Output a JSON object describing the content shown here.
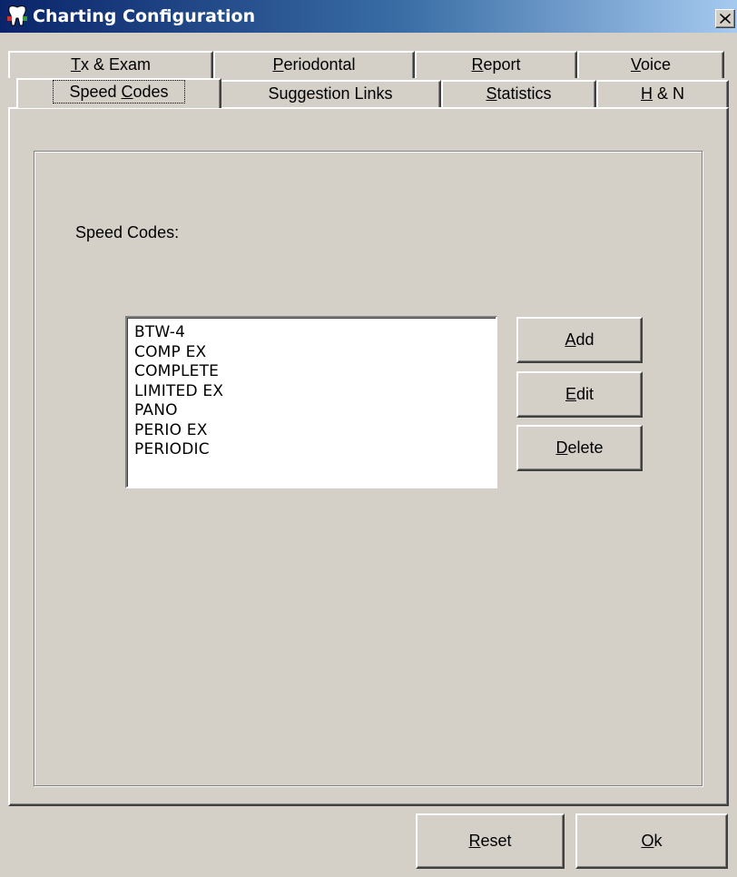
{
  "window": {
    "title": "Charting Configuration",
    "icon": "tooth-icon",
    "close_glyph": "✕"
  },
  "tabs": {
    "row_back": [
      {
        "pre": "",
        "accel": "T",
        "post": "x & Exam"
      },
      {
        "pre": "",
        "accel": "P",
        "post": "eriodontal"
      },
      {
        "pre": "",
        "accel": "R",
        "post": "eport"
      },
      {
        "pre": "",
        "accel": "V",
        "post": "oice"
      }
    ],
    "row_front": [
      {
        "pre": "Speed ",
        "accel": "C",
        "post": "odes",
        "active": true
      },
      {
        "pre": "Suggestion Links",
        "accel": "",
        "post": ""
      },
      {
        "pre": "",
        "accel": "S",
        "post": "tatistics"
      },
      {
        "pre": "",
        "accel": "H",
        "post": " & N"
      }
    ]
  },
  "panel": {
    "speed_codes_label": "Speed Codes:",
    "speed_codes": [
      "BTW-4",
      "COMP EX",
      "COMPLETE",
      "LIMITED EX",
      "PANO",
      "PERIO EX",
      "PERIODIC"
    ],
    "buttons": {
      "add": {
        "pre": "",
        "accel": "A",
        "post": "dd"
      },
      "edit": {
        "pre": "",
        "accel": "E",
        "post": "dit"
      },
      "delete": {
        "pre": "",
        "accel": "D",
        "post": "elete"
      }
    }
  },
  "footer": {
    "reset": {
      "pre": "",
      "accel": "R",
      "post": "eset"
    },
    "ok": {
      "pre": "",
      "accel": "O",
      "post": "k"
    }
  },
  "colors": {
    "titlebar_start": "#0a246a",
    "titlebar_end": "#a6caf0",
    "face": "#d4d0c8"
  }
}
